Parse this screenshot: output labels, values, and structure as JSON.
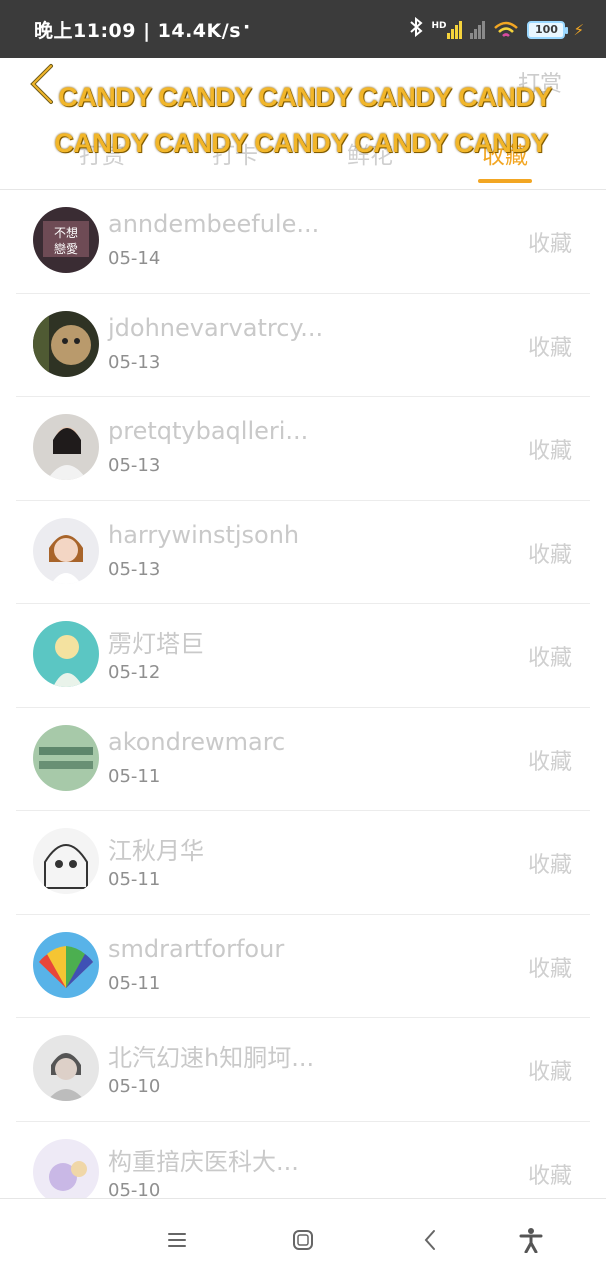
{
  "status_bar": {
    "time": "晚上11:09 | 14.4K/s",
    "dot": "·",
    "bluetooth_icon": "bluetooth-icon",
    "network_hd": "HD",
    "battery_level": "100"
  },
  "header": {
    "back_icon": "chevron-left-icon",
    "tip_link": "打赏",
    "tabs": [
      {
        "label": "打赏",
        "active": false
      },
      {
        "label": "打卡",
        "active": false
      },
      {
        "label": "鲜花",
        "active": false
      },
      {
        "label": "收藏",
        "active": true
      }
    ],
    "overlay_line1": "CANDY CANDY CANDY CANDY CANDY",
    "overlay_line2": "CANDY CANDY CANDY CANDY CANDY"
  },
  "list": {
    "items": [
      {
        "name": "anndembeefule...",
        "date": "05-14",
        "action": "收藏"
      },
      {
        "name": "jdohnevarvatrcy...",
        "date": "05-13",
        "action": "收藏"
      },
      {
        "name": "pretqtybaqlleri...",
        "date": "05-13",
        "action": "收藏"
      },
      {
        "name": "harrywinstjsonh",
        "date": "05-13",
        "action": "收藏"
      },
      {
        "name": "雳灯塔巨",
        "date": "05-12",
        "action": "收藏"
      },
      {
        "name": "akondrewmarc",
        "date": "05-11",
        "action": "收藏"
      },
      {
        "name": "江秋月华",
        "date": "05-11",
        "action": "收藏"
      },
      {
        "name": "smdrartforfour",
        "date": "05-11",
        "action": "收藏"
      },
      {
        "name": "北汽幻速h知胴坷...",
        "date": "05-10",
        "action": "收藏"
      },
      {
        "name": "构重揞庆医科大...",
        "date": "05-10",
        "action": "收藏"
      }
    ]
  },
  "colors": {
    "accent": "#f2a623",
    "status_bar_bg": "#3b3b3b",
    "muted_text": "#c9c9c9"
  },
  "navbar": {
    "icons": [
      "menu-icon",
      "home-square-icon",
      "back-chevron-icon",
      "accessibility-icon"
    ]
  }
}
